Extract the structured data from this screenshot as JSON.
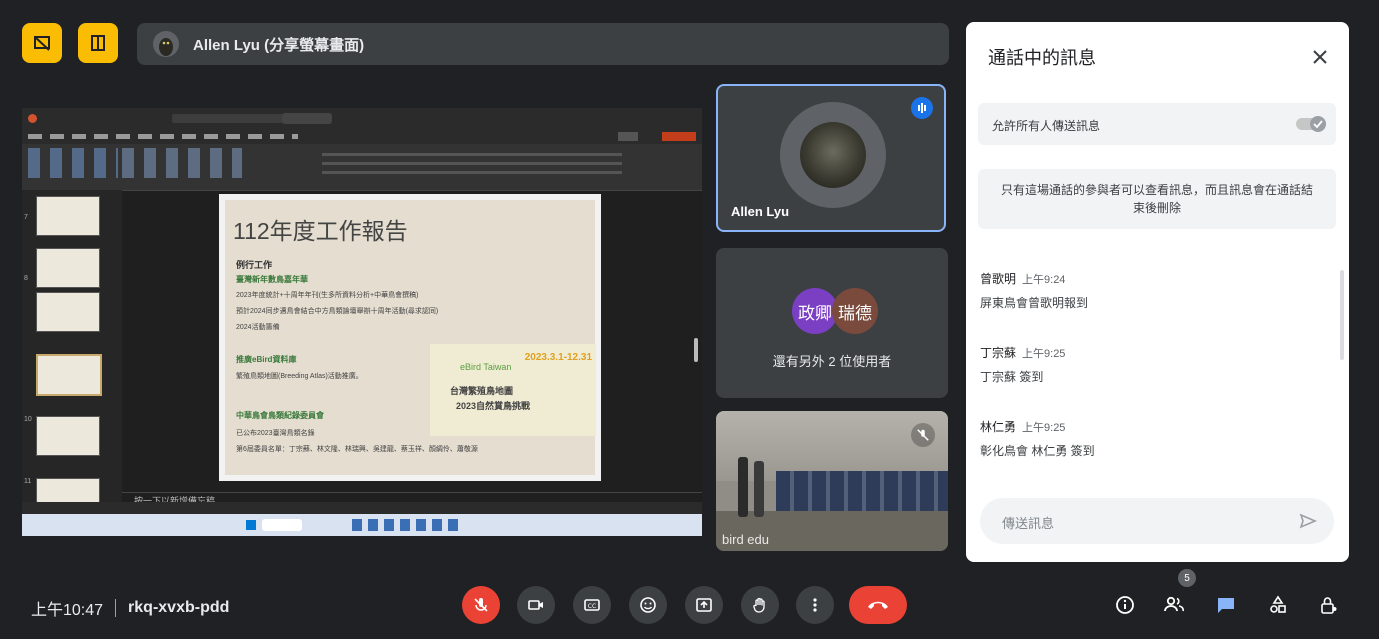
{
  "presenter_banner": {
    "name": "Allen Lyu (分享螢幕畫面)"
  },
  "shared_screen": {
    "slide": {
      "title": "112年度工作報告",
      "heading": "例行工作",
      "section1": "臺灣新年數鳥嘉年華",
      "bullets1": [
        "2023年度統計+十周年年刊(生多所資料分析+中華鳥會撰稿)",
        "預計2024同步邁鳥會結合中方鳥類論壇舉辦十周年活動(尋求認同)",
        "2024活動籌備"
      ],
      "section2": "推廣eBird資料庫",
      "bullets2": [
        "繁殖鳥類地圖(Breeding Atlas)活動推廣。"
      ],
      "section3": "中華鳥會鳥類紀錄委員會",
      "bullets3": [
        "已公布2023臺灣鳥類名錄",
        "第6屆委員名單：丁宗蘇、林文隆、林瑞興、吳建龍、蔡玉祥、顏綢伶、蕭敬源"
      ],
      "ebird_promo": {
        "brand": "eBird Taiwan",
        "dates": "2023.3.1-12.31",
        "line1": "台灣繁殖鳥地圖",
        "line2": "2023自然賞鳥挑戰"
      }
    },
    "notes_placeholder": "按一下以新增備忘稿"
  },
  "participants": {
    "tile1": {
      "name": "Allen Lyu"
    },
    "tile2": {
      "avatar1": "政卿",
      "avatar2": "瑞德",
      "text": "還有另外 2 位使用者"
    },
    "tile3": {
      "name": "bird edu"
    }
  },
  "chat": {
    "title": "通話中的訊息",
    "allow_label": "允許所有人傳送訊息",
    "info": "只有這場通話的參與者可以查看訊息，而且訊息會在通話結束後刪除",
    "messages": [
      {
        "sender": "曾歌明",
        "time": "上午9:24",
        "text": "屏東鳥會曾歌明報到"
      },
      {
        "sender": "丁宗蘇",
        "time": "上午9:25",
        "text": "丁宗蘇 簽到"
      },
      {
        "sender": "林仁勇",
        "time": "上午9:25",
        "text": "彰化鳥會 林仁勇 簽到"
      }
    ],
    "input_placeholder": "傳送訊息"
  },
  "bottom_bar": {
    "time": "上午10:47",
    "meeting_code": "rkq-xvxb-pdd",
    "people_count": "5"
  },
  "colors": {
    "accent": "#8ab4f8",
    "danger": "#ea4335",
    "brand_yellow": "#fbbc04",
    "chat_icon": "#8ab4f8"
  }
}
